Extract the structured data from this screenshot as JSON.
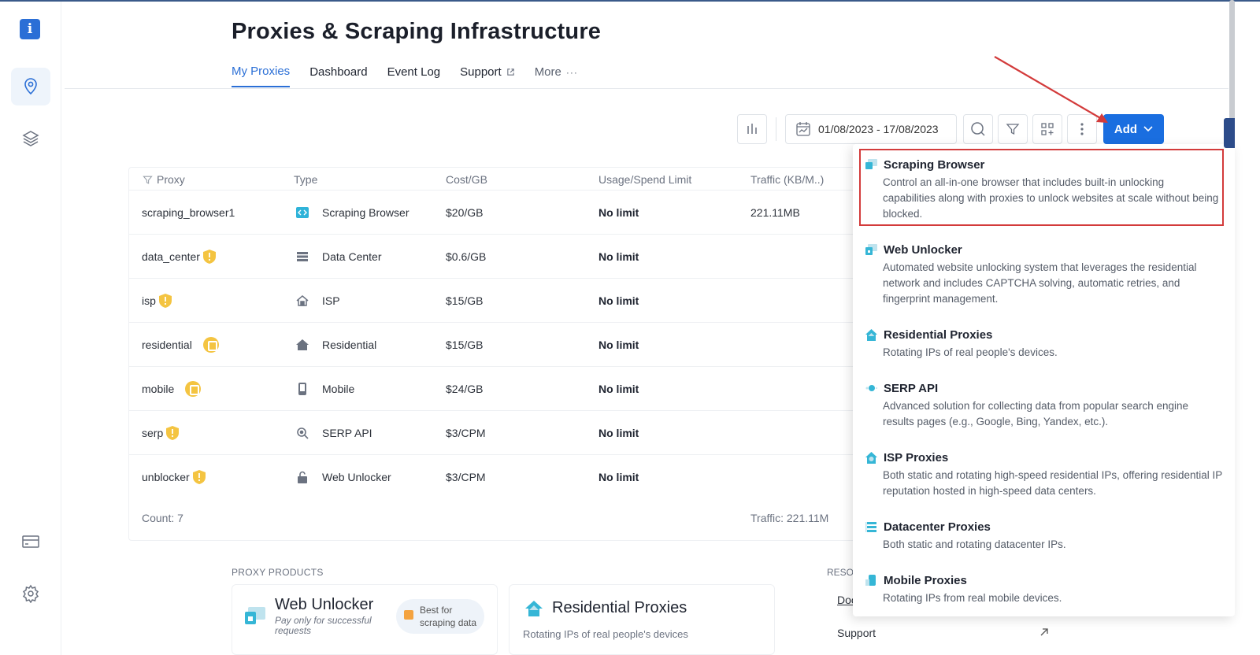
{
  "page": {
    "title": "Proxies & Scraping Infrastructure"
  },
  "tabs": [
    {
      "label": "My Proxies"
    },
    {
      "label": "Dashboard"
    },
    {
      "label": "Event Log"
    },
    {
      "label": "Support"
    },
    {
      "label": "More"
    }
  ],
  "toolbar": {
    "date_range": "01/08/2023 - 17/08/2023",
    "add_label": "Add"
  },
  "table": {
    "headers": [
      "Proxy",
      "Type",
      "Cost/GB",
      "Usage/Spend Limit",
      "Traffic (KB/M..)"
    ],
    "rows": [
      {
        "proxy": "scraping_browser1",
        "type": "Scraping Browser",
        "cost": "$20/GB",
        "limit": "No limit",
        "traffic": "221.11MB",
        "badge": "none",
        "icon": "code-icon"
      },
      {
        "proxy": "data_center",
        "type": "Data Center",
        "cost": "$0.6/GB",
        "limit": "No limit",
        "traffic": "",
        "badge": "shield",
        "icon": "server-icon"
      },
      {
        "proxy": "isp",
        "type": "ISP",
        "cost": "$15/GB",
        "limit": "No limit",
        "traffic": "",
        "badge": "shield",
        "icon": "house-icon"
      },
      {
        "proxy": "residential",
        "type": "Residential",
        "cost": "$15/GB",
        "limit": "No limit",
        "traffic": "",
        "badge": "lock",
        "icon": "home-icon"
      },
      {
        "proxy": "mobile",
        "type": "Mobile",
        "cost": "$24/GB",
        "limit": "No limit",
        "traffic": "",
        "badge": "lock",
        "icon": "phone-icon"
      },
      {
        "proxy": "serp",
        "type": "SERP API",
        "cost": "$3/CPM",
        "limit": "No limit",
        "traffic": "",
        "badge": "shield",
        "icon": "search-icon"
      },
      {
        "proxy": "unblocker",
        "type": "Web Unlocker",
        "cost": "$3/CPM",
        "limit": "No limit",
        "traffic": "",
        "badge": "shield",
        "icon": "lock-icon"
      }
    ],
    "count": "Count: 7",
    "traffic_total": "Traffic: 221.11M"
  },
  "products": {
    "label": "PROXY PRODUCTS",
    "web_unlocker": {
      "title": "Web Unlocker",
      "sub1": "Pay only for successful",
      "sub2": "requests",
      "badge1": "Best for",
      "badge2": "scraping data"
    },
    "residential": {
      "title": "Residential Proxies",
      "sub": "Rotating IPs of real people's devices"
    }
  },
  "resources": {
    "label": "RESOU",
    "link1": "Doc",
    "link2": "Support"
  },
  "dropdown": [
    {
      "title": "Scraping Browser",
      "desc": [
        "Control an all-in-one browser that includes built-in unlocking",
        "capabilities along with proxies to unlock websites at scale without being",
        "blocked."
      ]
    },
    {
      "title": "Web Unlocker",
      "desc": [
        "Automated website unlocking system that leverages the residential",
        "network and includes CAPTCHA solving, automatic retries, and",
        "fingerprint management."
      ]
    },
    {
      "title": "Residential Proxies",
      "desc": [
        "Rotating IPs of real people's devices."
      ]
    },
    {
      "title": "SERP API",
      "desc": [
        "Advanced solution for collecting data from popular search engine",
        "results pages (e.g., Google, Bing, Yandex, etc.)."
      ]
    },
    {
      "title": "ISP Proxies",
      "desc": [
        "Both static and rotating high-speed residential IPs, offering residential IP",
        "reputation hosted in high-speed data centers."
      ]
    },
    {
      "title": "Datacenter Proxies",
      "desc": [
        "Both static and rotating datacenter IPs."
      ]
    },
    {
      "title": "Mobile Proxies",
      "desc": [
        "Rotating IPs from real mobile devices."
      ]
    }
  ],
  "colors": {
    "accent": "#1a6ee0",
    "highlight": "#d33b3b",
    "badge": "#f4c441"
  }
}
